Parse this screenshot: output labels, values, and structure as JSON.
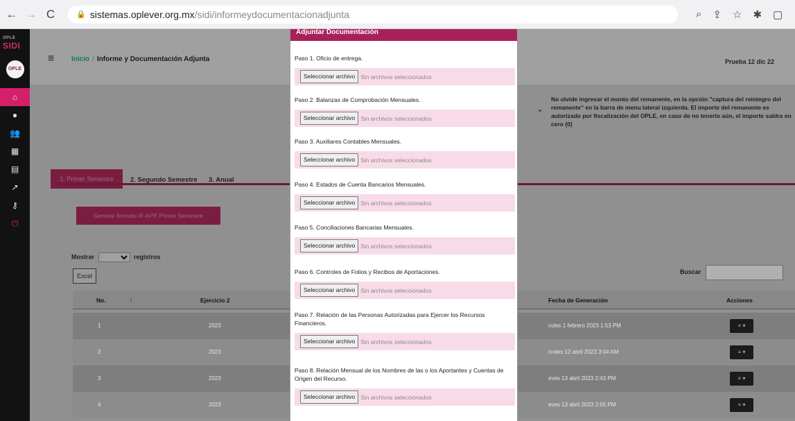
{
  "browser": {
    "back": "←",
    "forward": "→",
    "reload": "C",
    "url_domain": "sistemas.oplever.org.mx",
    "url_path": "/sidi/informeydocumentacionadjunta",
    "icons": [
      "zoom-icon",
      "share-icon",
      "star-icon",
      "extensions-icon",
      "window-icon"
    ]
  },
  "sidebar": {
    "logo_a": "OPLE ",
    "logo_b": "SIDI",
    "avatar": "OPLE",
    "items": [
      {
        "icon": "dashboard-icon",
        "glyph": "⌂",
        "active": true
      },
      {
        "icon": "circle-icon",
        "glyph": "●",
        "active": false
      },
      {
        "icon": "users-icon",
        "glyph": "👥",
        "active": false
      },
      {
        "icon": "calendar-icon",
        "glyph": "▦",
        "active": false
      },
      {
        "icon": "document-icon",
        "glyph": "▤",
        "active": false
      },
      {
        "icon": "chart-icon",
        "glyph": "↗",
        "active": false
      },
      {
        "icon": "key-icon",
        "glyph": "⚷",
        "active": false
      },
      {
        "icon": "power-icon",
        "glyph": "⏻",
        "active": false
      }
    ]
  },
  "header": {
    "breadcrumb_home": "Inicio",
    "breadcrumb_sep": "/",
    "breadcrumb_current": "Informe y Documentación Adjunta",
    "user": "Prueba 12 dic 22"
  },
  "notice": "No olvide ingresar el monto del remanente, en la opción \"captura del reintegro del remanente\" en la barra de menu lateral izquierda. El importe del remanente es autorizado por fiscalización del OPLE, en caso de no tenerlo aún, el importe saldra en cero (0)",
  "tabs": {
    "active": "1. Primer Semestre",
    "second": "2. Segundo Semestre",
    "third": "3. Anual"
  },
  "generate_button": "Generar formato IF-APE Primer Semestre",
  "table_controls": {
    "show_label": "Mostrar",
    "records_label": "registros",
    "excel": "Excel",
    "search_label": "Buscar"
  },
  "table": {
    "headers": {
      "no": "No.",
      "sort": "↑",
      "year": "Ejercicio 2",
      "date": "Fecha de Generación",
      "actions": "Acciones"
    },
    "rows": [
      {
        "no": "1",
        "year": "2023",
        "date": "coles 1 febrero 2023 1:53 PM",
        "action": "≡ ▾"
      },
      {
        "no": "2",
        "year": "2023",
        "date": "rcoles 12 abril 2023 3:04 AM",
        "action": "≡ ▾"
      },
      {
        "no": "3",
        "year": "2023",
        "date": "eves 13 abril 2023 2:43 PM",
        "action": "≡ ▾"
      },
      {
        "no": "4",
        "year": "2023",
        "date": "eves 13 abril 2023 2:55 PM",
        "action": "≡ ▾"
      }
    ]
  },
  "modal": {
    "header": "Adjuntar Documentación",
    "button_label": "Seleccionar archivo",
    "no_file_label": "Sin archivos seleccionados",
    "steps": [
      "Paso 1. Oficio de entrega.",
      "Paso 2. Balanzas de Comprobación Mensuales.",
      "Paso 3. Auxiliares Contables Mensuales.",
      "Paso 4. Estados de Cuenta Bancarios Mensuales.",
      "Paso 5. Conciliaciones Bancarias Mensuales.",
      "Paso 6. Controles de Folios y Recibos de Aportaciones.",
      "Paso 7. Relación de las Personas Autorizadas para Ejercer los Recursos Financieros.",
      "Paso 8. Relación Mensual de los Nombres de las o los Aportantes y Cuentas de Origen del Recurso."
    ]
  }
}
